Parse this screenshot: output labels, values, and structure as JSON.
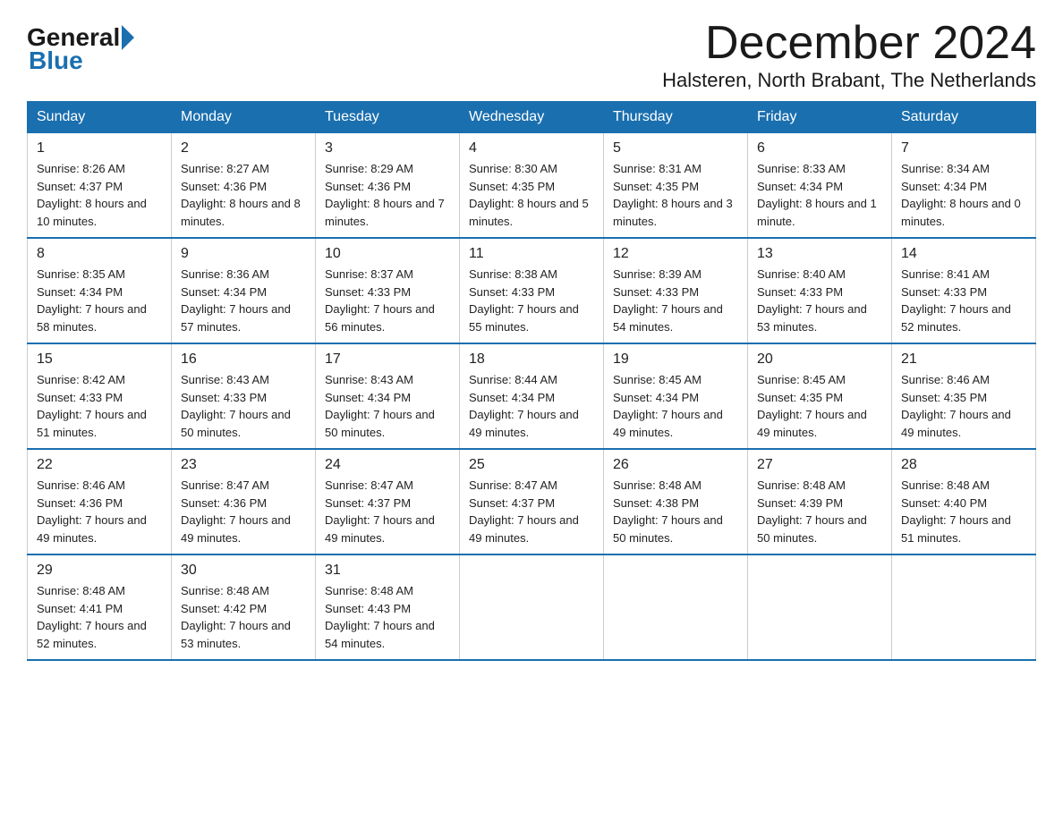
{
  "logo": {
    "general": "General",
    "arrow": "",
    "blue": "Blue"
  },
  "title": {
    "month_year": "December 2024",
    "location": "Halsteren, North Brabant, The Netherlands"
  },
  "weekdays": [
    "Sunday",
    "Monday",
    "Tuesday",
    "Wednesday",
    "Thursday",
    "Friday",
    "Saturday"
  ],
  "weeks": [
    [
      {
        "day": "1",
        "sunrise": "8:26 AM",
        "sunset": "4:37 PM",
        "daylight": "8 hours and 10 minutes."
      },
      {
        "day": "2",
        "sunrise": "8:27 AM",
        "sunset": "4:36 PM",
        "daylight": "8 hours and 8 minutes."
      },
      {
        "day": "3",
        "sunrise": "8:29 AM",
        "sunset": "4:36 PM",
        "daylight": "8 hours and 7 minutes."
      },
      {
        "day": "4",
        "sunrise": "8:30 AM",
        "sunset": "4:35 PM",
        "daylight": "8 hours and 5 minutes."
      },
      {
        "day": "5",
        "sunrise": "8:31 AM",
        "sunset": "4:35 PM",
        "daylight": "8 hours and 3 minutes."
      },
      {
        "day": "6",
        "sunrise": "8:33 AM",
        "sunset": "4:34 PM",
        "daylight": "8 hours and 1 minute."
      },
      {
        "day": "7",
        "sunrise": "8:34 AM",
        "sunset": "4:34 PM",
        "daylight": "8 hours and 0 minutes."
      }
    ],
    [
      {
        "day": "8",
        "sunrise": "8:35 AM",
        "sunset": "4:34 PM",
        "daylight": "7 hours and 58 minutes."
      },
      {
        "day": "9",
        "sunrise": "8:36 AM",
        "sunset": "4:34 PM",
        "daylight": "7 hours and 57 minutes."
      },
      {
        "day": "10",
        "sunrise": "8:37 AM",
        "sunset": "4:33 PM",
        "daylight": "7 hours and 56 minutes."
      },
      {
        "day": "11",
        "sunrise": "8:38 AM",
        "sunset": "4:33 PM",
        "daylight": "7 hours and 55 minutes."
      },
      {
        "day": "12",
        "sunrise": "8:39 AM",
        "sunset": "4:33 PM",
        "daylight": "7 hours and 54 minutes."
      },
      {
        "day": "13",
        "sunrise": "8:40 AM",
        "sunset": "4:33 PM",
        "daylight": "7 hours and 53 minutes."
      },
      {
        "day": "14",
        "sunrise": "8:41 AM",
        "sunset": "4:33 PM",
        "daylight": "7 hours and 52 minutes."
      }
    ],
    [
      {
        "day": "15",
        "sunrise": "8:42 AM",
        "sunset": "4:33 PM",
        "daylight": "7 hours and 51 minutes."
      },
      {
        "day": "16",
        "sunrise": "8:43 AM",
        "sunset": "4:33 PM",
        "daylight": "7 hours and 50 minutes."
      },
      {
        "day": "17",
        "sunrise": "8:43 AM",
        "sunset": "4:34 PM",
        "daylight": "7 hours and 50 minutes."
      },
      {
        "day": "18",
        "sunrise": "8:44 AM",
        "sunset": "4:34 PM",
        "daylight": "7 hours and 49 minutes."
      },
      {
        "day": "19",
        "sunrise": "8:45 AM",
        "sunset": "4:34 PM",
        "daylight": "7 hours and 49 minutes."
      },
      {
        "day": "20",
        "sunrise": "8:45 AM",
        "sunset": "4:35 PM",
        "daylight": "7 hours and 49 minutes."
      },
      {
        "day": "21",
        "sunrise": "8:46 AM",
        "sunset": "4:35 PM",
        "daylight": "7 hours and 49 minutes."
      }
    ],
    [
      {
        "day": "22",
        "sunrise": "8:46 AM",
        "sunset": "4:36 PM",
        "daylight": "7 hours and 49 minutes."
      },
      {
        "day": "23",
        "sunrise": "8:47 AM",
        "sunset": "4:36 PM",
        "daylight": "7 hours and 49 minutes."
      },
      {
        "day": "24",
        "sunrise": "8:47 AM",
        "sunset": "4:37 PM",
        "daylight": "7 hours and 49 minutes."
      },
      {
        "day": "25",
        "sunrise": "8:47 AM",
        "sunset": "4:37 PM",
        "daylight": "7 hours and 49 minutes."
      },
      {
        "day": "26",
        "sunrise": "8:48 AM",
        "sunset": "4:38 PM",
        "daylight": "7 hours and 50 minutes."
      },
      {
        "day": "27",
        "sunrise": "8:48 AM",
        "sunset": "4:39 PM",
        "daylight": "7 hours and 50 minutes."
      },
      {
        "day": "28",
        "sunrise": "8:48 AM",
        "sunset": "4:40 PM",
        "daylight": "7 hours and 51 minutes."
      }
    ],
    [
      {
        "day": "29",
        "sunrise": "8:48 AM",
        "sunset": "4:41 PM",
        "daylight": "7 hours and 52 minutes."
      },
      {
        "day": "30",
        "sunrise": "8:48 AM",
        "sunset": "4:42 PM",
        "daylight": "7 hours and 53 minutes."
      },
      {
        "day": "31",
        "sunrise": "8:48 AM",
        "sunset": "4:43 PM",
        "daylight": "7 hours and 54 minutes."
      },
      null,
      null,
      null,
      null
    ]
  ],
  "labels": {
    "sunrise": "Sunrise: ",
    "sunset": "Sunset: ",
    "daylight": "Daylight: "
  }
}
